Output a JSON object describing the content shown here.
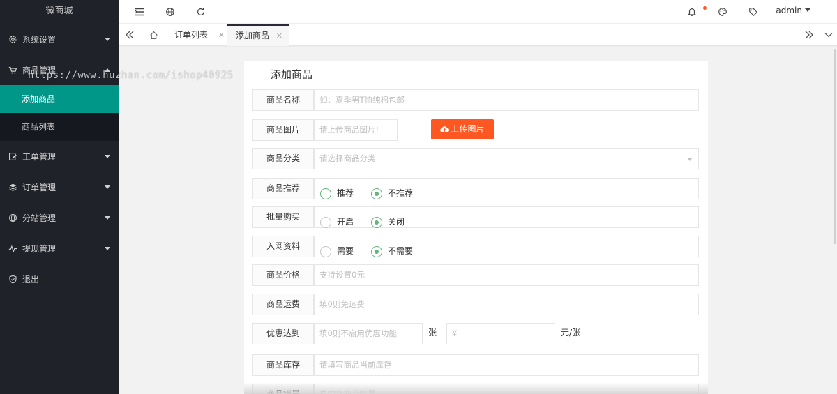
{
  "sidebar": {
    "logo": "微商城",
    "items": [
      {
        "label": "系统设置",
        "icon": "gear-icon"
      },
      {
        "label": "商品管理",
        "icon": "cart-icon"
      },
      {
        "label": "工单管理",
        "icon": "edit-icon"
      },
      {
        "label": "订单管理",
        "icon": "layers-icon"
      },
      {
        "label": "分站管理",
        "icon": "globe-icon"
      },
      {
        "label": "提现管理",
        "icon": "pulse-icon"
      },
      {
        "label": "退出",
        "icon": "shield-icon"
      }
    ],
    "submenu": [
      {
        "label": "添加商品",
        "active": true
      },
      {
        "label": "商品列表",
        "active": false
      }
    ]
  },
  "header": {
    "user": "admin",
    "icons": [
      "menu-fold-icon",
      "globe-icon",
      "refresh-icon",
      "bell-icon",
      "palette-icon",
      "tag-icon"
    ]
  },
  "tabs": [
    {
      "label": "订单列表",
      "active": false
    },
    {
      "label": "添加商品",
      "active": true
    }
  ],
  "watermark": "https://www.huzhan.com/ishop40925",
  "form": {
    "title": "添加商品",
    "rows": {
      "name": {
        "label": "商品名称",
        "placeholder": "如：夏季男T恤纯棉包邮"
      },
      "image": {
        "label": "商品图片",
        "placeholder": "请上传商品图片!",
        "button": "上传图片"
      },
      "category": {
        "label": "商品分类",
        "placeholder": "请选择商品分类"
      },
      "recommend": {
        "label": "商品推荐",
        "options": [
          "推荐",
          "不推荐"
        ],
        "selected": 1
      },
      "batch": {
        "label": "批量购买",
        "options": [
          "开启",
          "关闭"
        ],
        "selected": 1
      },
      "network": {
        "label": "入网资料",
        "options": [
          "需要",
          "不需要"
        ],
        "selected": 1
      },
      "price": {
        "label": "商品价格",
        "placeholder": "支持设置0元"
      },
      "shipping": {
        "label": "商品运费",
        "placeholder": "填0则免运费"
      },
      "discount": {
        "label": "优惠达到",
        "placeholder": "填0则不启用优惠功能",
        "mid": "张 -",
        "yen": "¥",
        "unit": "元/张"
      },
      "stock": {
        "label": "商品库存",
        "placeholder": "请填写商品当前库存"
      },
      "sales": {
        "label": "商品销量",
        "placeholder": "自定义商品销量"
      }
    }
  },
  "colors": {
    "sidebar": "#20222a",
    "active": "#009688",
    "upload": "#ff5722",
    "radio": "#5fb878"
  }
}
